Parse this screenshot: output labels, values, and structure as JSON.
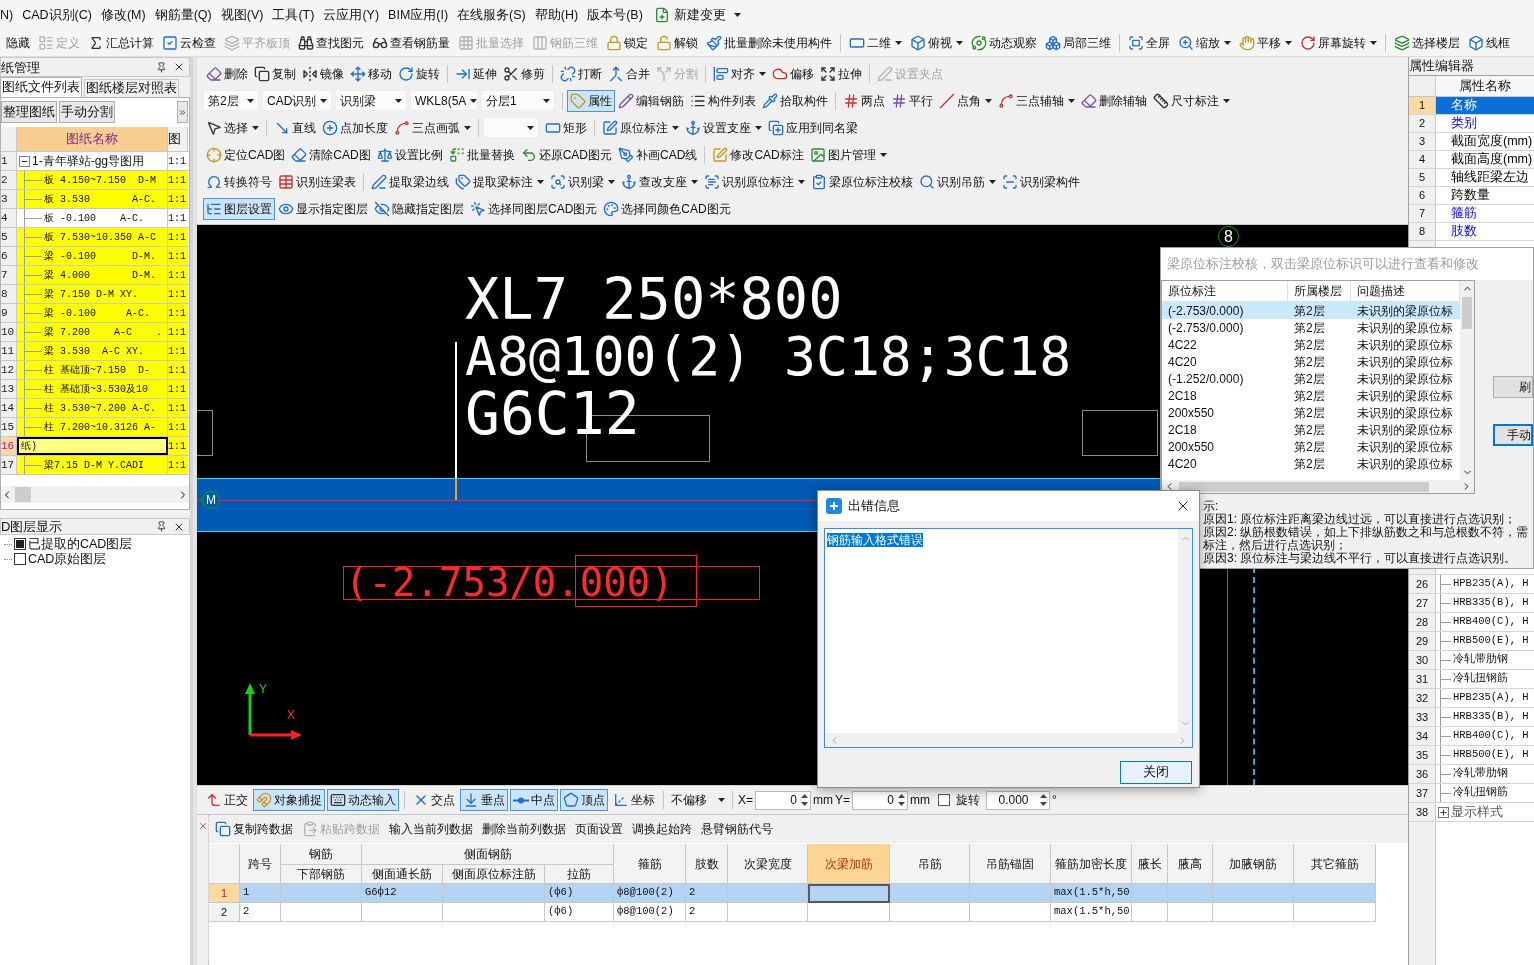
{
  "menu_bar": {
    "items": [
      "N)",
      "CAD识别(C)",
      "修改(M)",
      "钢筋量(Q)",
      "视图(V)",
      "工具(T)",
      "云应用(Y)",
      "BIM应用(I)",
      "在线服务(S)",
      "帮助(H)",
      "版本号(B)"
    ],
    "new_change": "新建变更"
  },
  "main_toolbar": {
    "groups": [
      [
        {
          "label": "隐藏",
          "kind": "button",
          "disabled": false
        },
        {
          "label": "定义",
          "kind": "button",
          "disabled": true
        },
        {
          "label": "汇总计算",
          "kind": "button",
          "disabled": false
        },
        {
          "label": "云检查",
          "kind": "button",
          "disabled": false
        },
        {
          "label": "平齐板顶",
          "kind": "button",
          "disabled": true
        },
        {
          "label": "查找图元",
          "kind": "button",
          "disabled": false
        },
        {
          "label": "查看钢筋量",
          "kind": "button",
          "disabled": false
        },
        {
          "label": "批量选择",
          "kind": "button",
          "disabled": true
        },
        {
          "label": "钢筋三维",
          "kind": "button",
          "disabled": true
        },
        {
          "label": "锁定",
          "kind": "button",
          "disabled": false
        },
        {
          "label": "解锁",
          "kind": "button",
          "disabled": false
        },
        {
          "label": "批量删除未使用构件",
          "kind": "button",
          "disabled": false
        }
      ],
      [
        {
          "label": "二维",
          "kind": "menu",
          "disabled": false
        },
        {
          "label": "俯视",
          "kind": "menu",
          "disabled": false
        },
        {
          "label": "动态观察",
          "kind": "button",
          "disabled": false
        },
        {
          "label": "局部三维",
          "kind": "button",
          "disabled": false
        }
      ],
      [
        {
          "label": "全屏",
          "kind": "button",
          "disabled": false
        },
        {
          "label": "缩放",
          "kind": "menu",
          "disabled": false
        },
        {
          "label": "平移",
          "kind": "menu",
          "disabled": false
        },
        {
          "label": "屏幕旋转",
          "kind": "menu",
          "disabled": false
        }
      ],
      [
        {
          "label": "选择楼层",
          "kind": "button",
          "disabled": false
        },
        {
          "label": "线框",
          "kind": "button",
          "disabled": false
        }
      ]
    ]
  },
  "drawing_manager": {
    "title": "纸管理",
    "tabs": [
      {
        "label": "图纸文件列表",
        "selected": true
      },
      {
        "label": "图纸楼层对照表",
        "selected": false
      }
    ],
    "buttons": [
      "整理图纸",
      "手动分割"
    ],
    "columns": [
      {
        "label": "图纸名称",
        "selected": true
      },
      {
        "label": "图",
        "selected": false
      }
    ],
    "rows": [
      {
        "num": "1",
        "name": "1-青年驿站-gg导图用",
        "scale": "1:1",
        "kind": "group",
        "highlighted": false,
        "selected": false
      },
      {
        "num": "2",
        "name": "板 4.150~7.150  D-M",
        "scale": "1:1",
        "kind": "leaf",
        "highlighted": true,
        "selected": false
      },
      {
        "num": "3",
        "name": "板 3.530       A-C.",
        "scale": "1:1",
        "kind": "leaf",
        "highlighted": true,
        "selected": false
      },
      {
        "num": "4",
        "name": "板 -0.100    A-C.",
        "scale": "1:1",
        "kind": "leaf",
        "highlighted": false,
        "selected": false
      },
      {
        "num": "5",
        "name": "板 7.530~10.350 A-C",
        "scale": "1:1",
        "kind": "leaf",
        "highlighted": true,
        "selected": false
      },
      {
        "num": "6",
        "name": "梁 -0.100      D-M.",
        "scale": "1:1",
        "kind": "leaf",
        "highlighted": true,
        "selected": false
      },
      {
        "num": "7",
        "name": "梁 4.000       D-M.",
        "scale": "1:1",
        "kind": "leaf",
        "highlighted": true,
        "selected": false
      },
      {
        "num": "8",
        "name": "梁 7.150 D-M XY.",
        "scale": "1:1",
        "kind": "leaf",
        "highlighted": true,
        "selected": false
      },
      {
        "num": "9",
        "name": "梁 -0.100     A-C.",
        "scale": "1:1",
        "kind": "leaf",
        "highlighted": true,
        "selected": false
      },
      {
        "num": "10",
        "name": "梁 7.200    A-C    .",
        "scale": "1:1",
        "kind": "leaf",
        "highlighted": true,
        "selected": false
      },
      {
        "num": "11",
        "name": "梁 3.530  A-C XY.",
        "scale": "1:1",
        "kind": "leaf",
        "highlighted": true,
        "selected": false
      },
      {
        "num": "12",
        "name": "柱 基础顶~7.150  D-",
        "scale": "1:1",
        "kind": "leaf",
        "highlighted": true,
        "selected": false
      },
      {
        "num": "13",
        "name": "柱 基础顶~3.530及10",
        "scale": "1:1",
        "kind": "leaf",
        "highlighted": true,
        "selected": false
      },
      {
        "num": "14",
        "name": "柱 3.530~7.200 A-C.",
        "scale": "1:1",
        "kind": "leaf",
        "highlighted": true,
        "selected": false
      },
      {
        "num": "15",
        "name": "柱 7.200~10.3126 A-",
        "scale": "1:1",
        "kind": "leaf",
        "highlighted": true,
        "selected": false
      },
      {
        "num": "16",
        "name": "纸)",
        "scale": "1:1",
        "kind": "leaf",
        "highlighted": true,
        "selected": true
      },
      {
        "num": "17",
        "name": "梁7.15 D-M Y.CADI",
        "scale": "1:1",
        "kind": "leaf",
        "highlighted": true,
        "selected": false
      }
    ]
  },
  "layer_panel": {
    "title": "D图层显示",
    "items": [
      {
        "label": "已提取的CAD图层",
        "checked": true
      },
      {
        "label": "CAD原始图层",
        "checked": false
      }
    ]
  },
  "toolbars": [
    {
      "groups": [
        [
          {
            "label": "删除",
            "kind": "button",
            "disabled": false
          },
          {
            "label": "复制",
            "kind": "button",
            "disabled": false
          },
          {
            "label": "镜像",
            "kind": "button",
            "disabled": false
          },
          {
            "label": "移动",
            "kind": "button",
            "disabled": false
          },
          {
            "label": "旋转",
            "kind": "button",
            "disabled": false
          }
        ],
        [
          {
            "label": "延伸",
            "kind": "button",
            "disabled": false
          },
          {
            "label": "修剪",
            "kind": "button",
            "disabled": false
          }
        ],
        [
          {
            "label": "打断",
            "kind": "button",
            "disabled": false
          },
          {
            "label": "合并",
            "kind": "button",
            "disabled": false
          },
          {
            "label": "分割",
            "kind": "button",
            "disabled": true
          }
        ],
        [
          {
            "label": "对齐",
            "kind": "menu",
            "disabled": false
          },
          {
            "label": "偏移",
            "kind": "button",
            "disabled": false
          },
          {
            "label": "拉伸",
            "kind": "button",
            "disabled": false
          }
        ],
        [
          {
            "label": "设置夹点",
            "kind": "button",
            "disabled": true
          }
        ]
      ]
    },
    {
      "groups": [
        [
          {
            "label": "第2层",
            "kind": "select",
            "on": false
          },
          {
            "label": "CAD识别",
            "kind": "select",
            "on": false
          },
          {
            "label": "识别梁",
            "kind": "select",
            "on": false
          },
          {
            "label": "WKL8(5A",
            "kind": "select",
            "on": false
          },
          {
            "label": "分层1",
            "kind": "select",
            "on": false
          }
        ],
        [
          {
            "label": "属性",
            "kind": "button",
            "on": true
          },
          {
            "label": "编辑钢筋",
            "kind": "button",
            "on": false
          },
          {
            "label": "构件列表",
            "kind": "button",
            "on": false
          },
          {
            "label": "拾取构件",
            "kind": "button",
            "on": false
          }
        ],
        [
          {
            "label": "两点",
            "kind": "button",
            "on": false
          },
          {
            "label": "平行",
            "kind": "button",
            "on": false
          },
          {
            "label": "点角",
            "kind": "menu",
            "on": false
          },
          {
            "label": "三点辅轴",
            "kind": "menu",
            "on": false
          },
          {
            "label": "删除辅轴",
            "kind": "button",
            "on": false
          },
          {
            "label": "尺寸标注",
            "kind": "menu",
            "on": false
          }
        ]
      ]
    },
    {
      "groups": [
        [
          {
            "label": "选择",
            "kind": "menu"
          }
        ],
        [
          {
            "label": "直线",
            "kind": "button"
          },
          {
            "label": "点加长度",
            "kind": "button"
          },
          {
            "label": "三点画弧",
            "kind": "menu"
          }
        ],
        [
          {
            "kind": "select"
          },
          {
            "label": "矩形",
            "kind": "button"
          }
        ],
        [
          {
            "label": "原位标注",
            "kind": "menu"
          },
          {
            "label": "设置支座",
            "kind": "menu"
          },
          {
            "label": "应用到同名梁",
            "kind": "button"
          }
        ]
      ]
    },
    {
      "groups": [
        [
          {
            "label": "定位CAD图",
            "kind": "button"
          },
          {
            "label": "清除CAD图",
            "kind": "button"
          },
          {
            "label": "设置比例",
            "kind": "button"
          },
          {
            "label": "批量替换",
            "kind": "button"
          },
          {
            "label": "还原CAD图元",
            "kind": "button"
          },
          {
            "label": "补画CAD线",
            "kind": "button"
          }
        ],
        [
          {
            "label": "修改CAD标注",
            "kind": "button"
          },
          {
            "label": "图片管理",
            "kind": "menu"
          }
        ]
      ]
    },
    {
      "groups": [
        [
          {
            "label": "转换符号",
            "kind": "button"
          },
          {
            "label": "识别连梁表",
            "kind": "button"
          }
        ],
        [
          {
            "label": "提取梁边线",
            "kind": "button"
          },
          {
            "label": "提取梁标注",
            "kind": "menu"
          },
          {
            "label": "识别梁",
            "kind": "menu"
          },
          {
            "label": "查改支座",
            "kind": "menu"
          },
          {
            "label": "识别原位标注",
            "kind": "menu"
          },
          {
            "label": "梁原位标注校核",
            "kind": "button"
          },
          {
            "label": "识别吊筋",
            "kind": "menu"
          },
          {
            "label": "识别梁构件",
            "kind": "button"
          }
        ]
      ]
    },
    {
      "groups": [
        [
          {
            "label": "图层设置",
            "kind": "button",
            "on": true
          },
          {
            "label": "显示指定图层",
            "kind": "button",
            "on": false
          },
          {
            "label": "隐藏指定图层",
            "kind": "button",
            "on": false
          },
          {
            "label": "选择同图层CAD图元",
            "kind": "button",
            "on": false
          },
          {
            "label": "选择同颜色CAD图元",
            "kind": "button",
            "on": false
          }
        ]
      ]
    }
  ],
  "canvas": {
    "beam_text": [
      "XL7 250*800",
      "A8@100(2) 3C18;3C18",
      "G6C12"
    ],
    "annotation": "(-2.753/0.000)",
    "axis_bubbles": [
      "M",
      "8"
    ],
    "axes": {
      "x": "X",
      "y": "Y"
    }
  },
  "check_panel": {
    "title": "梁原位标注校核，双击梁原位标识可以进行查看和修改",
    "columns": [
      "原位标注",
      "所属楼层",
      "问题描述"
    ],
    "rows": [
      {
        "cells": [
          "(-2.753/0.000)",
          "第2层",
          "未识别的梁原位标"
        ],
        "selected": true
      },
      {
        "cells": [
          "(-2.753/0.000)",
          "第2层",
          "未识别的梁原位标"
        ],
        "selected": false
      },
      {
        "cells": [
          "4C22",
          "第2层",
          "未识别的梁原位标"
        ],
        "selected": false
      },
      {
        "cells": [
          "4C20",
          "第2层",
          "未识别的梁原位标"
        ],
        "selected": false
      },
      {
        "cells": [
          "(-1.252/0.000)",
          "第2层",
          "未识别的梁原位标"
        ],
        "selected": false
      },
      {
        "cells": [
          "2C18",
          "第2层",
          "未识别的梁原位标"
        ],
        "selected": false
      },
      {
        "cells": [
          "200x550",
          "第2层",
          "未识别的梁原位标"
        ],
        "selected": false
      },
      {
        "cells": [
          "2C18",
          "第2层",
          "未识别的梁原位标"
        ],
        "selected": false
      },
      {
        "cells": [
          "200x550",
          "第2层",
          "未识别的梁原位标"
        ],
        "selected": false
      },
      {
        "cells": [
          "4C20",
          "第2层",
          "未识别的梁原位标"
        ],
        "selected": false
      }
    ],
    "buttons": [
      "刷",
      "手动"
    ],
    "tips": [
      "示:",
      "原因1: 原位标注距离梁边线过远，可以直接进行点选识别；",
      "原因2: 纵筋根数错误，如上下排纵筋数之和与总根数不符，需",
      "标注，然后进行点选识别；",
      "原因3: 原位标注与梁边线不平行，可以直接进行点选识别。"
    ]
  },
  "error_dialog": {
    "title": "出错信息",
    "message": {
      "text": "钢筋输入格式错误",
      "selected": true
    },
    "button": "关闭"
  },
  "snap_bar": {
    "groups": [
      [
        {
          "label": "正交",
          "kind": "button",
          "on": false
        },
        {
          "label": "对象捕捉",
          "kind": "button",
          "on": true
        },
        {
          "label": "动态输入",
          "kind": "button",
          "on": true
        }
      ],
      [
        {
          "label": "交点",
          "kind": "button",
          "on": false
        },
        {
          "label": "垂点",
          "kind": "button",
          "on": true
        },
        {
          "label": "中点",
          "kind": "button",
          "on": true
        },
        {
          "label": "顶点",
          "kind": "button",
          "on": true
        },
        {
          "label": "坐标",
          "kind": "button",
          "on": false
        }
      ]
    ],
    "offset": "不偏移",
    "x": {
      "label": "X=",
      "value": "0",
      "unit": "mm"
    },
    "y": {
      "label": "Y=",
      "value": "0",
      "unit": "mm"
    },
    "rotate": {
      "label": "旋转",
      "checked": false,
      "value": "0.000",
      "unit": "°"
    }
  },
  "span_table": {
    "toolbar": [
      {
        "label": "复制跨数据",
        "kind": "button",
        "disabled": false
      },
      {
        "label": "粘贴跨数据",
        "kind": "button",
        "disabled": true
      },
      {
        "label": "输入当前列数据",
        "kind": "button",
        "disabled": false
      },
      {
        "label": "删除当前列数据",
        "kind": "button",
        "disabled": false
      },
      {
        "label": "页面设置",
        "kind": "button",
        "disabled": false
      },
      {
        "label": "调换起始跨",
        "kind": "button",
        "disabled": false
      },
      {
        "label": "悬臂钢筋代号",
        "kind": "button",
        "disabled": false
      }
    ],
    "columns": [
      {
        "label": "跨号",
        "selected": false
      },
      {
        "label": "钢筋",
        "selected": false,
        "sub": [
          "下部钢筋"
        ]
      },
      {
        "label": "侧面钢筋",
        "selected": false,
        "sub": [
          "侧面通长筋",
          "侧面原位标注筋",
          "拉筋"
        ]
      },
      {
        "label": "箍筋",
        "selected": false
      },
      {
        "label": "肢数",
        "selected": false
      },
      {
        "label": "次梁宽度",
        "selected": false
      },
      {
        "label": "次梁加筋",
        "selected": true
      },
      {
        "label": "吊筋",
        "selected": false
      },
      {
        "label": "吊筋锚固",
        "selected": false
      },
      {
        "label": "箍筋加密长度",
        "selected": false
      },
      {
        "label": "腋长",
        "selected": false
      },
      {
        "label": "腋高",
        "selected": false
      },
      {
        "label": "加腋钢筋",
        "selected": false
      },
      {
        "label": "其它箍筋",
        "selected": false
      }
    ],
    "rows": [
      {
        "num": "1",
        "selected": true,
        "cells": [
          "1",
          null,
          "G6ф12",
          null,
          "(ф6)",
          "ф8@100(2)",
          "2",
          null,
          null,
          null,
          null,
          "max(1.5*h,50",
          null,
          null,
          null,
          null
        ]
      },
      {
        "num": "2",
        "selected": false,
        "cells": [
          "2",
          null,
          null,
          null,
          "(ф6)",
          "ф8@100(2)",
          "2",
          null,
          null,
          null,
          null,
          "max(1.5*h,50",
          null,
          null,
          null,
          null
        ]
      }
    ]
  },
  "property_editor": {
    "title": "属性编辑器",
    "header": "属性名称",
    "rows": [
      {
        "num": "1",
        "label": "名称",
        "selected": true
      },
      {
        "num": "2",
        "label": "类别",
        "selected": false,
        "kind": "public"
      },
      {
        "num": "3",
        "label": "截面宽度(mm)",
        "selected": false,
        "kind": "private"
      },
      {
        "num": "4",
        "label": "截面高度(mm)",
        "selected": false,
        "kind": "private"
      },
      {
        "num": "5",
        "label": "轴线距梁左边",
        "selected": false,
        "kind": "private"
      },
      {
        "num": "6",
        "label": "跨数量",
        "selected": false,
        "kind": "private"
      },
      {
        "num": "7",
        "label": "箍筋",
        "selected": false,
        "kind": "public"
      },
      {
        "num": "8",
        "label": "肢数",
        "selected": false,
        "kind": "public"
      }
    ],
    "more_rows": [
      {
        "num": "26",
        "label": "HPB235(A), H",
        "kind": "child"
      },
      {
        "num": "27",
        "label": "HRB335(B), H",
        "kind": "child"
      },
      {
        "num": "28",
        "label": "HRB400(C), H",
        "kind": "child"
      },
      {
        "num": "29",
        "label": "HRB500(E), H",
        "kind": "child"
      },
      {
        "num": "30",
        "label": "冷轧带肋钢",
        "kind": "child"
      },
      {
        "num": "31",
        "label": "冷轧扭钢筋",
        "kind": "child"
      },
      {
        "num": "32",
        "label": "HPB235(A), H",
        "kind": "child"
      },
      {
        "num": "33",
        "label": "HRB335(B), H",
        "kind": "child"
      },
      {
        "num": "34",
        "label": "HRB400(C), H",
        "kind": "child"
      },
      {
        "num": "35",
        "label": "HRB500(E), H",
        "kind": "child"
      },
      {
        "num": "36",
        "label": "冷轧带肋钢",
        "kind": "child"
      },
      {
        "num": "37",
        "label": "冷轧扭钢筋",
        "kind": "child"
      },
      {
        "num": "38",
        "label": "显示样式",
        "kind": "collapsed"
      }
    ]
  }
}
